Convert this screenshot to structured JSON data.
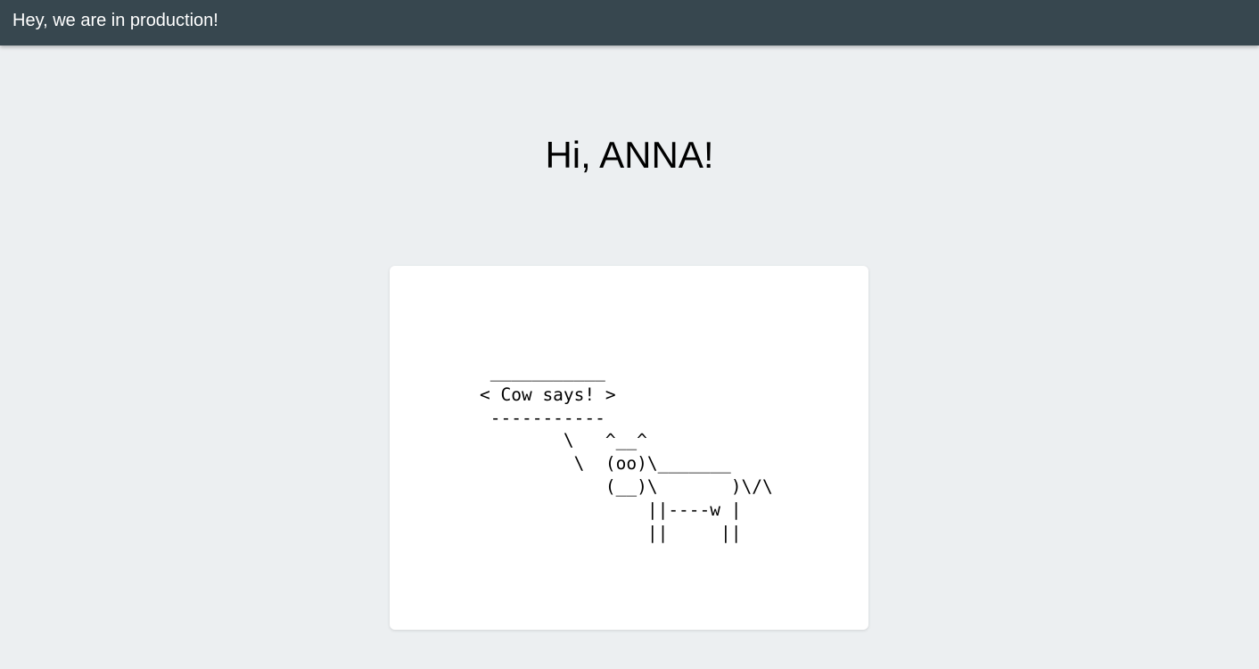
{
  "header": {
    "title": "Hey, we are in production!",
    "background": "#37474f"
  },
  "main": {
    "greeting": "Hi, ANNA!"
  },
  "card": {
    "cowsay": " ___________\n< Cow says! >\n -----------\n        \\   ^__^\n         \\  (oo)\\_______\n            (__)\\       )\\/\\\n                ||----w |\n                ||     ||"
  },
  "colors": {
    "page_background": "#eceff1",
    "card_background": "#ffffff"
  }
}
